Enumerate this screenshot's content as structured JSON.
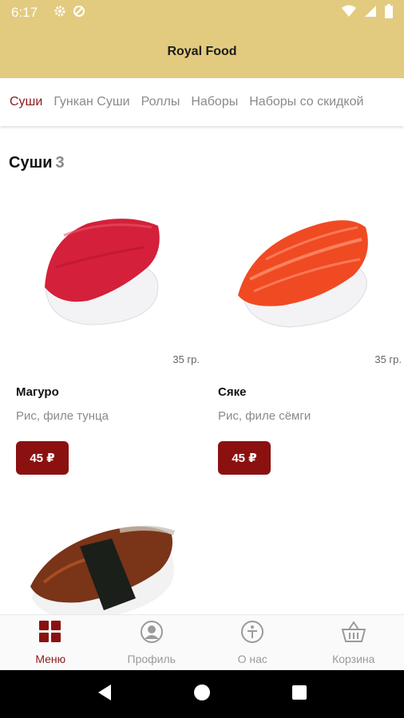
{
  "status_bar": {
    "time": "6:17",
    "icons": [
      "gear-icon",
      "sync-icon",
      "wifi-icon",
      "signal-icon",
      "battery-icon"
    ]
  },
  "app": {
    "title": "Royal Food"
  },
  "tabs": [
    {
      "label": "Суши",
      "active": true
    },
    {
      "label": "Гункан Суши",
      "active": false
    },
    {
      "label": "Роллы",
      "active": false
    },
    {
      "label": "Наборы",
      "active": false
    },
    {
      "label": "Наборы со скидкой",
      "active": false
    }
  ],
  "section": {
    "title": "Суши",
    "count": "3"
  },
  "products": [
    {
      "name": "Магуро",
      "description": "Рис, филе тунца",
      "weight": "35 гр.",
      "price": "45 ₽"
    },
    {
      "name": "Сяке",
      "description": "Рис, филе сёмги",
      "weight": "35 гр.",
      "price": "45 ₽"
    }
  ],
  "bottom_nav": [
    {
      "label": "Меню",
      "icon": "menu-grid-icon",
      "active": true
    },
    {
      "label": "Профиль",
      "icon": "profile-icon",
      "active": false
    },
    {
      "label": "О нас",
      "icon": "about-icon",
      "active": false
    },
    {
      "label": "Корзина",
      "icon": "basket-icon",
      "active": false
    }
  ],
  "colors": {
    "accent": "#8b1111",
    "header": "#e2cb7f",
    "inactive": "#9a9a9a"
  }
}
